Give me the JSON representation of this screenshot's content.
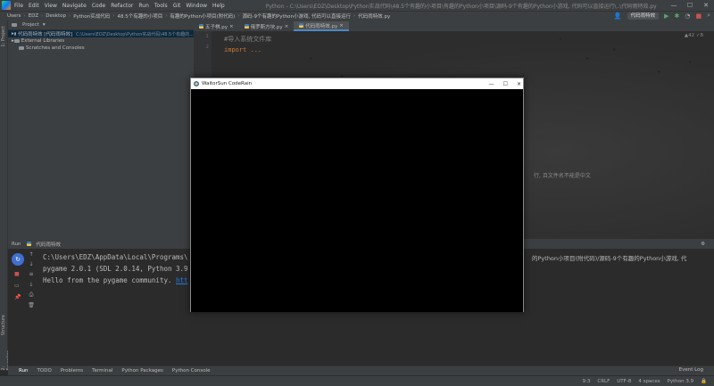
{
  "menubar": {
    "items": [
      "File",
      "Edit",
      "View",
      "Navigate",
      "Code",
      "Refactor",
      "Run",
      "Tools",
      "Git",
      "Window",
      "Help"
    ],
    "title": "Python - C:\\Users\\EDZ\\Desktop\\Python实战代码\\48.5个有趣的小项目\\有趣的Python小项目\\源码-9个有趣的Python小游戏, 代码可以直接运行\\..\\代码雨特效.py"
  },
  "window_controls": {
    "minimize": "—",
    "maximize": "☐",
    "close": "✕"
  },
  "navbar": {
    "crumbs": [
      "Users",
      "EDZ",
      "Desktop",
      "Python实战代码",
      "48.5个有趣的小项目",
      "有趣的Python小项目(附代码)",
      "源码-9个有趣的Python小游戏, 代码可以直接运行",
      "代码雨特效.py"
    ],
    "run_config": "代码雨特效"
  },
  "sidebar": {
    "project_label": "1: Project",
    "structure_label": "Structure",
    "favorites_label": "2: Favorites"
  },
  "project": {
    "header": "Project",
    "root_name": "代码雨特效 [代码雨特效]",
    "root_path": "C:\\Users\\EDZ\\Desktop\\Python实战代码\\48.5个有趣的...",
    "items": [
      "External Libraries",
      "Scratches and Consoles"
    ]
  },
  "tabs": [
    {
      "label": "五子棋.py",
      "active": false
    },
    {
      "label": "俄罗斯方块.py",
      "active": false
    },
    {
      "label": "代码雨特效.py",
      "active": true
    }
  ],
  "editor": {
    "lines": [
      "1",
      "2"
    ],
    "code_line1": "#导入系统文件库",
    "code_line2": "import ...",
    "inspection": "▲42 ✓8",
    "hint": "行, 且文件名不能是中文"
  },
  "run_panel": {
    "tab_label": "Run",
    "config_label": "代码雨特效",
    "output_line1": "C:\\Users\\EDZ\\AppData\\Local\\Programs\\",
    "output_line2": "pygame 2.0.1 (SDL 2.0.14, Python 3.9",
    "output_line3_prefix": "Hello from the pygame community. ",
    "output_line3_link": "htt",
    "output_right": "的Python小项目(附代码)/源码-9个有趣的Python小游戏, 代"
  },
  "bottom_tabs": [
    "Run",
    "TODO",
    "Problems",
    "Terminal",
    "Python Packages",
    "Python Console"
  ],
  "event_log": "Event Log",
  "status": {
    "position": "9:3",
    "line_sep": "CRLF",
    "encoding": "UTF-8",
    "indent": "4 spaces",
    "interpreter": "Python 3.9"
  },
  "dialog": {
    "title": "WaitorSun CodeRain",
    "minimize": "—",
    "maximize": "☐",
    "close": "✕"
  }
}
